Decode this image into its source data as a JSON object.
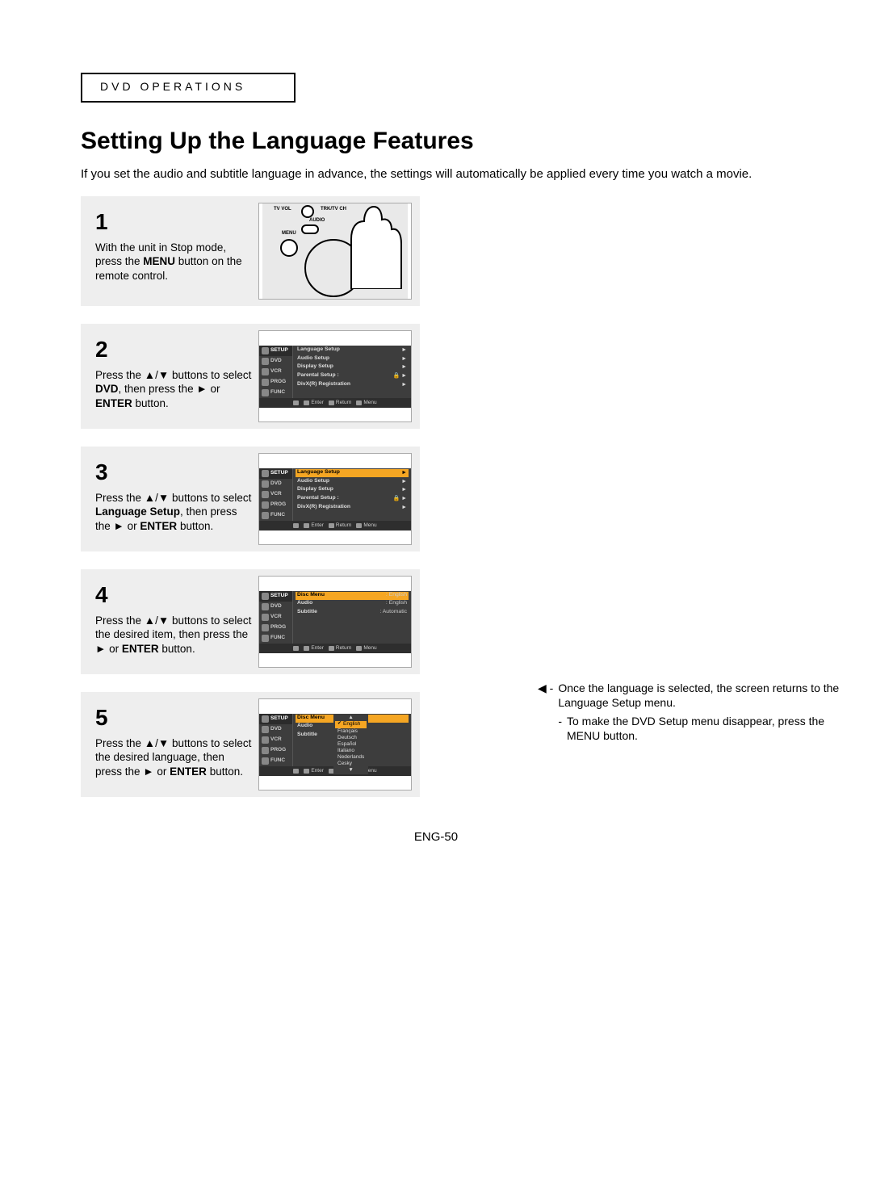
{
  "section": {
    "label": "DVD OPERATIONS"
  },
  "title": "Setting Up the Language Features",
  "intro": "If you set the audio and subtitle language in advance, the settings will automatically be applied every time you watch a movie.",
  "symbols": {
    "up": "▲",
    "down": "▼",
    "left": "◀",
    "right": "►",
    "slash": "/"
  },
  "steps": {
    "s1": {
      "num": "1",
      "t1": "With the unit in Stop mode, press the ",
      "b1": "MENU",
      "t2": " button on the remote control.",
      "remote": {
        "tvvol": "TV VOL",
        "trk": "TRK/TV CH",
        "audio": "AUDIO",
        "menu": "MENU"
      }
    },
    "s2": {
      "num": "2",
      "t1": "Press the ",
      "t2": " buttons to select ",
      "b1": "DVD",
      "t3": ", then press the ",
      "t4": " or ",
      "b2": "ENTER",
      "t5": " button."
    },
    "s3": {
      "num": "3",
      "t1": "Press the ",
      "t2": "  buttons to select ",
      "b1": "Language Setup",
      "t3": ", then press the ",
      "t4": " or ",
      "b2": "ENTER",
      "t5": " button."
    },
    "s4": {
      "num": "4",
      "t1": "Press the ",
      "t2": " buttons to select the desired item, then press the ",
      "t3": " or ",
      "b1": "ENTER",
      "t4": " button."
    },
    "s5": {
      "num": "5",
      "t1": "Press the ",
      "t2": " buttons to select the desired language, then press the ",
      "t3": " or ",
      "b1": "ENTER",
      "t4": " button."
    }
  },
  "osd": {
    "side": {
      "setup": "SETUP",
      "dvd": "DVD",
      "vcr": "VCR",
      "prog": "PROG",
      "func": "FUNC"
    },
    "menu1": {
      "items": [
        "Language Setup",
        "Audio Setup",
        "Display Setup",
        "Parental Setup :",
        "DivX(R) Registration"
      ],
      "lock": "🔒"
    },
    "menu4": {
      "items": [
        {
          "k": "Disc Menu",
          "v": ": English"
        },
        {
          "k": "Audio",
          "v": ": English"
        },
        {
          "k": "Subtitle",
          "v": ": Automatic"
        }
      ]
    },
    "menu5": {
      "left": [
        "Disc Menu",
        "Audio",
        "Subtitle"
      ],
      "langs": [
        "English",
        "Français",
        "Deutsch",
        "Español",
        "Italiano",
        "Nederlands",
        "Cesky"
      ],
      "arrow_up": "▲",
      "arrow_down": "▼"
    },
    "bottom": {
      "enter": "Enter",
      "ret": "Return",
      "menu": "Menu"
    }
  },
  "notes": {
    "lead": "◀ - ",
    "n1": "Once the language is selected, the screen returns to the Language Setup menu.",
    "dash": "-",
    "n2": "To make the DVD Setup menu disappear, press the MENU button."
  },
  "footer": "ENG-50"
}
